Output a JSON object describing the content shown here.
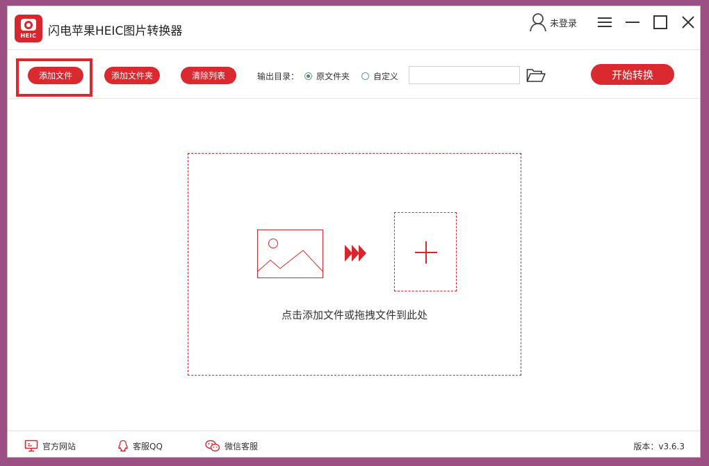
{
  "app": {
    "title": "闪电苹果HEIC图片转换器",
    "icon_badge": "HEIC",
    "accent": "#da2a2f"
  },
  "header": {
    "login_label": "未登录",
    "icons": [
      "user-icon",
      "menu-icon",
      "minimize-icon",
      "maximize-icon",
      "close-icon"
    ]
  },
  "toolbar": {
    "add_file": "添加文件",
    "add_folder": "添加文件夹",
    "clear_list": "清除列表",
    "output_label": "输出目录：",
    "radio_original": "原文件夹",
    "radio_custom": "自定义",
    "selected_output": "原文件夹",
    "path_value": "",
    "start": "开始转换"
  },
  "dropzone": {
    "hint": "点击添加文件或拖拽文件到此处"
  },
  "footer": {
    "website": "官方网站",
    "qq": "客服QQ",
    "wechat": "微信客服",
    "version": "版本：v3.6.3"
  }
}
